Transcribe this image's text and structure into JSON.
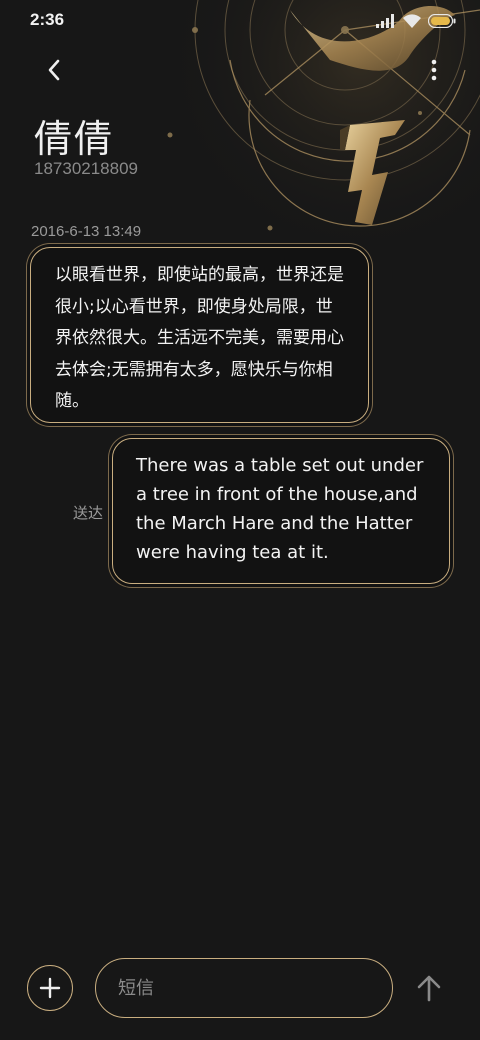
{
  "status_bar": {
    "time": "2:36",
    "icons": [
      "signal-icon",
      "wifi-icon",
      "battery-icon"
    ]
  },
  "header": {
    "back_icon": "chevron-left-icon",
    "more_icon": "more-vertical-icon",
    "contact_name": "倩倩",
    "contact_number": "18730218809"
  },
  "conversation": {
    "timestamp": "2016-6-13 13:49",
    "messages": [
      {
        "direction": "incoming",
        "text": "以眼看世界，即使站的最高，世界还是很小;以心看世界，即使身处局限，世界依然很大。生活远不完美，需要用心去体会;无需拥有太多，愿快乐与你相随。"
      },
      {
        "direction": "outgoing",
        "status": "送达",
        "text": "There was a table set out under a tree in front of the house,and the March Hare and the Hatter were having tea at it."
      }
    ]
  },
  "composer": {
    "add_icon": "plus-icon",
    "placeholder": "短信",
    "value": "",
    "send_icon": "arrow-up-icon"
  },
  "colors": {
    "background": "#171717",
    "accent_gold": "#c9ae80",
    "text_primary": "#f3f3f3",
    "text_secondary": "#8a8a8a"
  }
}
